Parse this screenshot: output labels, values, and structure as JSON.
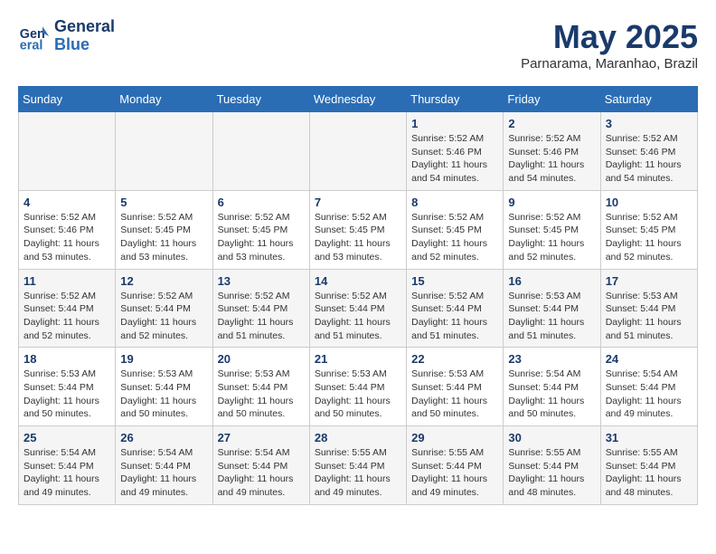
{
  "header": {
    "logo_line1": "General",
    "logo_line2": "Blue",
    "month": "May 2025",
    "location": "Parnarama, Maranhao, Brazil"
  },
  "weekdays": [
    "Sunday",
    "Monday",
    "Tuesday",
    "Wednesday",
    "Thursday",
    "Friday",
    "Saturday"
  ],
  "weeks": [
    [
      {
        "day": "",
        "info": ""
      },
      {
        "day": "",
        "info": ""
      },
      {
        "day": "",
        "info": ""
      },
      {
        "day": "",
        "info": ""
      },
      {
        "day": "1",
        "info": "Sunrise: 5:52 AM\nSunset: 5:46 PM\nDaylight: 11 hours\nand 54 minutes."
      },
      {
        "day": "2",
        "info": "Sunrise: 5:52 AM\nSunset: 5:46 PM\nDaylight: 11 hours\nand 54 minutes."
      },
      {
        "day": "3",
        "info": "Sunrise: 5:52 AM\nSunset: 5:46 PM\nDaylight: 11 hours\nand 54 minutes."
      }
    ],
    [
      {
        "day": "4",
        "info": "Sunrise: 5:52 AM\nSunset: 5:46 PM\nDaylight: 11 hours\nand 53 minutes."
      },
      {
        "day": "5",
        "info": "Sunrise: 5:52 AM\nSunset: 5:45 PM\nDaylight: 11 hours\nand 53 minutes."
      },
      {
        "day": "6",
        "info": "Sunrise: 5:52 AM\nSunset: 5:45 PM\nDaylight: 11 hours\nand 53 minutes."
      },
      {
        "day": "7",
        "info": "Sunrise: 5:52 AM\nSunset: 5:45 PM\nDaylight: 11 hours\nand 53 minutes."
      },
      {
        "day": "8",
        "info": "Sunrise: 5:52 AM\nSunset: 5:45 PM\nDaylight: 11 hours\nand 52 minutes."
      },
      {
        "day": "9",
        "info": "Sunrise: 5:52 AM\nSunset: 5:45 PM\nDaylight: 11 hours\nand 52 minutes."
      },
      {
        "day": "10",
        "info": "Sunrise: 5:52 AM\nSunset: 5:45 PM\nDaylight: 11 hours\nand 52 minutes."
      }
    ],
    [
      {
        "day": "11",
        "info": "Sunrise: 5:52 AM\nSunset: 5:44 PM\nDaylight: 11 hours\nand 52 minutes."
      },
      {
        "day": "12",
        "info": "Sunrise: 5:52 AM\nSunset: 5:44 PM\nDaylight: 11 hours\nand 52 minutes."
      },
      {
        "day": "13",
        "info": "Sunrise: 5:52 AM\nSunset: 5:44 PM\nDaylight: 11 hours\nand 51 minutes."
      },
      {
        "day": "14",
        "info": "Sunrise: 5:52 AM\nSunset: 5:44 PM\nDaylight: 11 hours\nand 51 minutes."
      },
      {
        "day": "15",
        "info": "Sunrise: 5:52 AM\nSunset: 5:44 PM\nDaylight: 11 hours\nand 51 minutes."
      },
      {
        "day": "16",
        "info": "Sunrise: 5:53 AM\nSunset: 5:44 PM\nDaylight: 11 hours\nand 51 minutes."
      },
      {
        "day": "17",
        "info": "Sunrise: 5:53 AM\nSunset: 5:44 PM\nDaylight: 11 hours\nand 51 minutes."
      }
    ],
    [
      {
        "day": "18",
        "info": "Sunrise: 5:53 AM\nSunset: 5:44 PM\nDaylight: 11 hours\nand 50 minutes."
      },
      {
        "day": "19",
        "info": "Sunrise: 5:53 AM\nSunset: 5:44 PM\nDaylight: 11 hours\nand 50 minutes."
      },
      {
        "day": "20",
        "info": "Sunrise: 5:53 AM\nSunset: 5:44 PM\nDaylight: 11 hours\nand 50 minutes."
      },
      {
        "day": "21",
        "info": "Sunrise: 5:53 AM\nSunset: 5:44 PM\nDaylight: 11 hours\nand 50 minutes."
      },
      {
        "day": "22",
        "info": "Sunrise: 5:53 AM\nSunset: 5:44 PM\nDaylight: 11 hours\nand 50 minutes."
      },
      {
        "day": "23",
        "info": "Sunrise: 5:54 AM\nSunset: 5:44 PM\nDaylight: 11 hours\nand 50 minutes."
      },
      {
        "day": "24",
        "info": "Sunrise: 5:54 AM\nSunset: 5:44 PM\nDaylight: 11 hours\nand 49 minutes."
      }
    ],
    [
      {
        "day": "25",
        "info": "Sunrise: 5:54 AM\nSunset: 5:44 PM\nDaylight: 11 hours\nand 49 minutes."
      },
      {
        "day": "26",
        "info": "Sunrise: 5:54 AM\nSunset: 5:44 PM\nDaylight: 11 hours\nand 49 minutes."
      },
      {
        "day": "27",
        "info": "Sunrise: 5:54 AM\nSunset: 5:44 PM\nDaylight: 11 hours\nand 49 minutes."
      },
      {
        "day": "28",
        "info": "Sunrise: 5:55 AM\nSunset: 5:44 PM\nDaylight: 11 hours\nand 49 minutes."
      },
      {
        "day": "29",
        "info": "Sunrise: 5:55 AM\nSunset: 5:44 PM\nDaylight: 11 hours\nand 49 minutes."
      },
      {
        "day": "30",
        "info": "Sunrise: 5:55 AM\nSunset: 5:44 PM\nDaylight: 11 hours\nand 48 minutes."
      },
      {
        "day": "31",
        "info": "Sunrise: 5:55 AM\nSunset: 5:44 PM\nDaylight: 11 hours\nand 48 minutes."
      }
    ]
  ]
}
